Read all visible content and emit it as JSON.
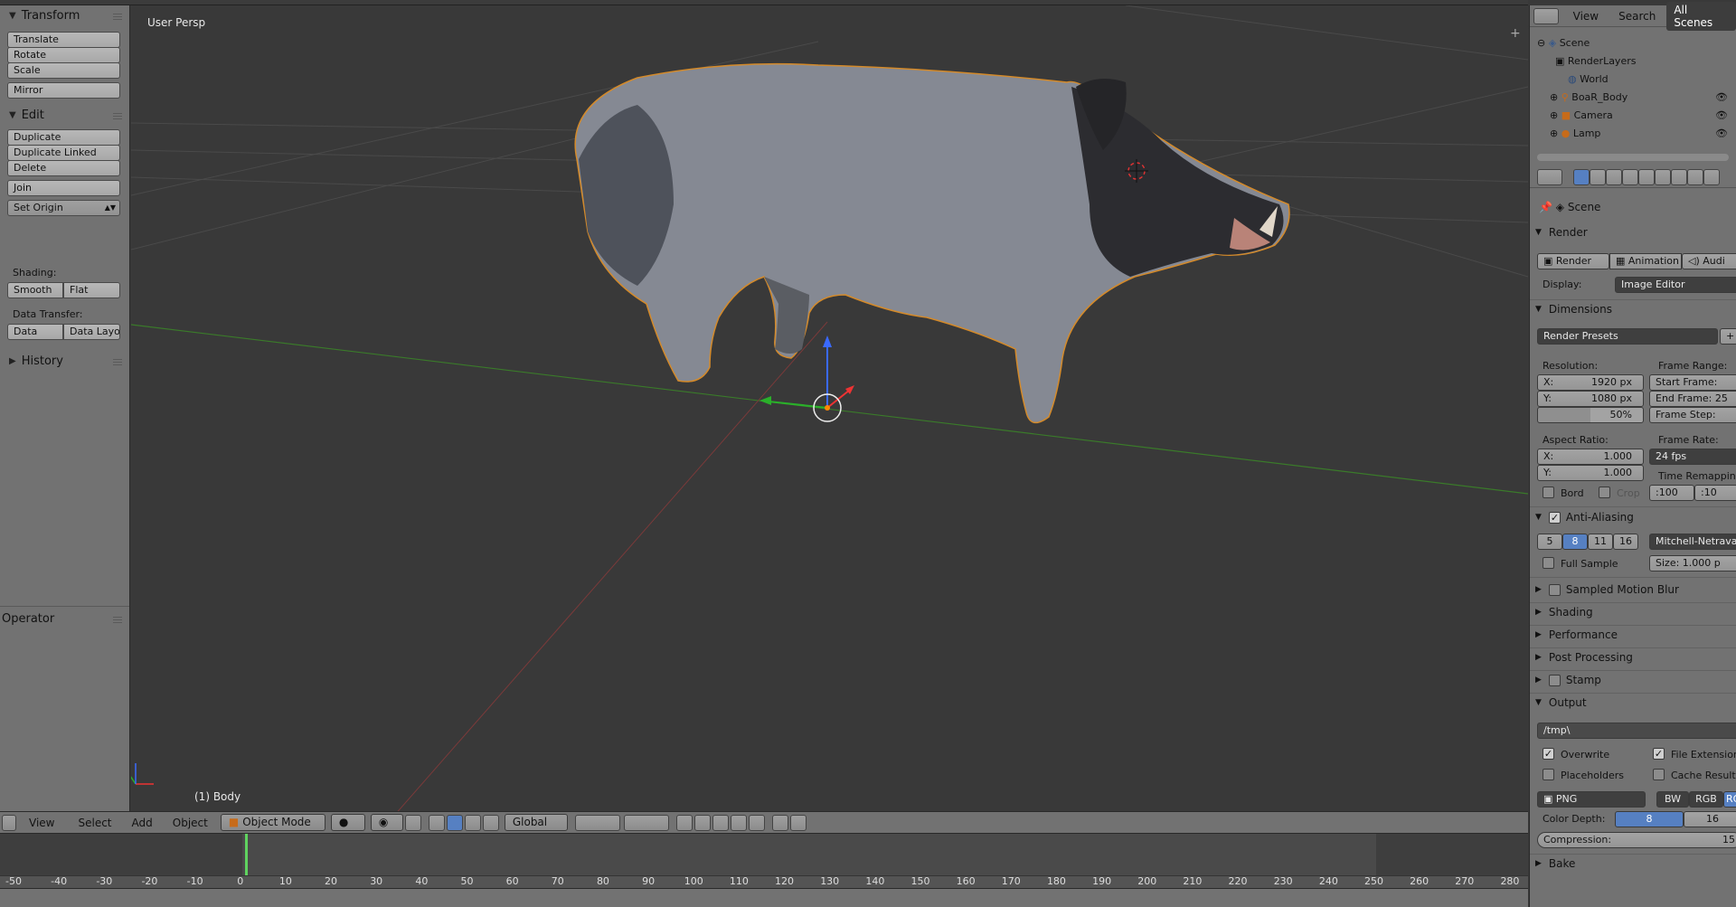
{
  "toolshelf": {
    "transform": {
      "title": "Transform",
      "translate": "Translate",
      "rotate": "Rotate",
      "scale": "Scale",
      "mirror": "Mirror"
    },
    "edit": {
      "title": "Edit",
      "duplicate": "Duplicate",
      "duplicate_linked": "Duplicate Linked",
      "delete": "Delete",
      "join": "Join",
      "set_origin": "Set Origin",
      "shading_label": "Shading:",
      "smooth": "Smooth",
      "flat": "Flat",
      "data_transfer_label": "Data Transfer:",
      "data": "Data",
      "data_layout": "Data Layo"
    },
    "history": "History",
    "operator": "Operator"
  },
  "viewport": {
    "view_label": "User Persp",
    "object_label": "(1) Body"
  },
  "header": {
    "view": "View",
    "select": "Select",
    "add": "Add",
    "object": "Object",
    "mode": "Object Mode",
    "orientation": "Global"
  },
  "timeline": {
    "ticks": [
      "-50",
      "-40",
      "-30",
      "-20",
      "-10",
      "0",
      "10",
      "20",
      "30",
      "40",
      "50",
      "60",
      "70",
      "80",
      "90",
      "100",
      "110",
      "120",
      "130",
      "140",
      "150",
      "160",
      "170",
      "180",
      "190",
      "200",
      "210",
      "220",
      "230",
      "240",
      "250",
      "260",
      "270",
      "280"
    ]
  },
  "outliner": {
    "tabs": {
      "view": "View",
      "search": "Search",
      "all_scenes": "All Scenes"
    },
    "items": [
      {
        "label": "Scene"
      },
      {
        "label": "RenderLayers"
      },
      {
        "label": "World"
      },
      {
        "label": "BoaR_Body"
      },
      {
        "label": "Camera"
      },
      {
        "label": "Lamp"
      }
    ]
  },
  "properties": {
    "context": "Scene",
    "render": {
      "title": "Render",
      "render_btn": "Render",
      "animation_btn": "Animation",
      "audio_btn": "Audi",
      "display_label": "Display:",
      "display_value": "Image Editor"
    },
    "dimensions": {
      "title": "Dimensions",
      "presets": "Render Presets",
      "resolution_label": "Resolution:",
      "res_x": "X:",
      "res_x_val": "1920 px",
      "res_y": "Y:",
      "res_y_val": "1080 px",
      "res_pct": "50%",
      "frame_range_label": "Frame Range:",
      "start_frame": "Start Frame:",
      "end_frame": "End Frame: 25",
      "frame_step": "Frame Step:",
      "aspect_label": "Aspect Ratio:",
      "asp_x": "X:",
      "asp_x_val": "1.000",
      "asp_y": "Y:",
      "asp_y_val": "1.000",
      "frame_rate_label": "Frame Rate:",
      "frame_rate_val": "24 fps",
      "time_remap_label": "Time Remapping",
      "remap_old": "100",
      "remap_new": ":10",
      "border": "Bord",
      "crop": "Crop"
    },
    "anti_aliasing": {
      "title": "Anti-Aliasing",
      "samples": [
        "5",
        "8",
        "11",
        "16"
      ],
      "filter": "Mitchell-Netrava",
      "full_sample": "Full Sample",
      "size": "Size:",
      "size_val": "1.000 p"
    },
    "sections": [
      "Sampled Motion Blur",
      "Shading",
      "Performance",
      "Post Processing",
      "Stamp"
    ],
    "output": {
      "title": "Output",
      "path": "/tmp\\",
      "overwrite": "Overwrite",
      "file_ext": "File Extension",
      "placeholders": "Placeholders",
      "cache_result": "Cache Result",
      "format": "PNG",
      "bw": "BW",
      "rgb": "RGB",
      "rgba": "RG",
      "color_depth_label": "Color Depth:",
      "depth_8": "8",
      "depth_16": "16",
      "compression": "Compression:",
      "compression_val": "15"
    },
    "bake": "Bake"
  }
}
